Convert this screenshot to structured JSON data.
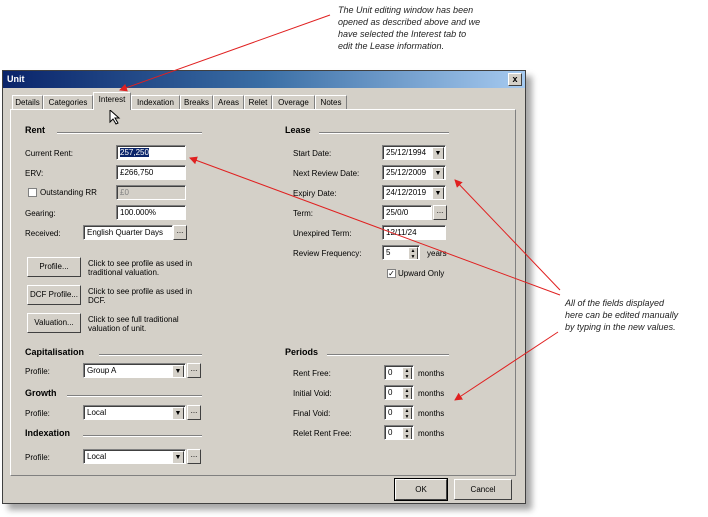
{
  "annotations": {
    "top": [
      "The Unit editing window has been",
      "opened as described above and we",
      "have selected the Interest tab to",
      "edit the Lease information."
    ],
    "right": [
      "All of the fields displayed",
      "here can be edited manually",
      "by typing in the new values."
    ]
  },
  "window": {
    "title": "Unit",
    "close": "x"
  },
  "tabs": [
    "Details",
    "Categories",
    "Interest",
    "Indexation",
    "Breaks",
    "Areas",
    "Relet",
    "Overage",
    "Notes"
  ],
  "active_tab": "Interest",
  "rent": {
    "heading": "Rent",
    "current_rent_label": "Current Rent:",
    "current_rent": "257,250",
    "erv_label": "ERV:",
    "erv": "£266,750",
    "outstanding_label": "Outstanding RR",
    "outstanding": "£0",
    "gearing_label": "Gearing:",
    "gearing": "100.000%",
    "received_label": "Received:",
    "received": "English Quarter Days",
    "received_btn": "...",
    "profile_btn": "Profile...",
    "profile_desc": [
      "Click to see profile as used in",
      "traditional valuation."
    ],
    "dcf_btn": "DCF Profile...",
    "dcf_desc": [
      "Click to see profile as used in",
      "DCF."
    ],
    "valuation_btn": "Valuation...",
    "valuation_desc": [
      "Click to see full traditional",
      "valuation of unit."
    ]
  },
  "capitalisation": {
    "heading": "Capitalisation",
    "profile_label": "Profile:",
    "profile": "Group A"
  },
  "growth": {
    "heading": "Growth",
    "profile_label": "Profile:",
    "profile": "Local"
  },
  "indexation": {
    "heading": "Indexation",
    "profile_label": "Profile:",
    "profile": "Local"
  },
  "lease": {
    "heading": "Lease",
    "start_label": "Start Date:",
    "start": "25/12/1994",
    "next_review_label": "Next Review Date:",
    "next_review": "25/12/2009",
    "expiry_label": "Expiry Date:",
    "expiry": "24/12/2019",
    "term_label": "Term:",
    "term": "25/0/0",
    "unexpired_label": "Unexpired Term:",
    "unexpired": "12/11/24",
    "review_freq_label": "Review Frequency:",
    "review_freq": "5",
    "years": "years",
    "upward_only_label": "Upward Only",
    "upward_only": "✓"
  },
  "periods": {
    "heading": "Periods",
    "rows": [
      {
        "label": "Rent Free:",
        "value": "0",
        "unit": "months"
      },
      {
        "label": "Initial Void:",
        "value": "0",
        "unit": "months"
      },
      {
        "label": "Final Void:",
        "value": "0",
        "unit": "months"
      },
      {
        "label": "Relet Rent Free:",
        "value": "0",
        "unit": "months"
      }
    ]
  },
  "footer": {
    "ok": "OK",
    "cancel": "Cancel"
  },
  "glyphs": {
    "dd": "▼",
    "ellipsis": "...",
    "up": "▲",
    "down": "▼"
  },
  "colors": {
    "titlebar": "#0a246a",
    "dialog": "#d4d0c8",
    "arrow": "#e02020"
  }
}
